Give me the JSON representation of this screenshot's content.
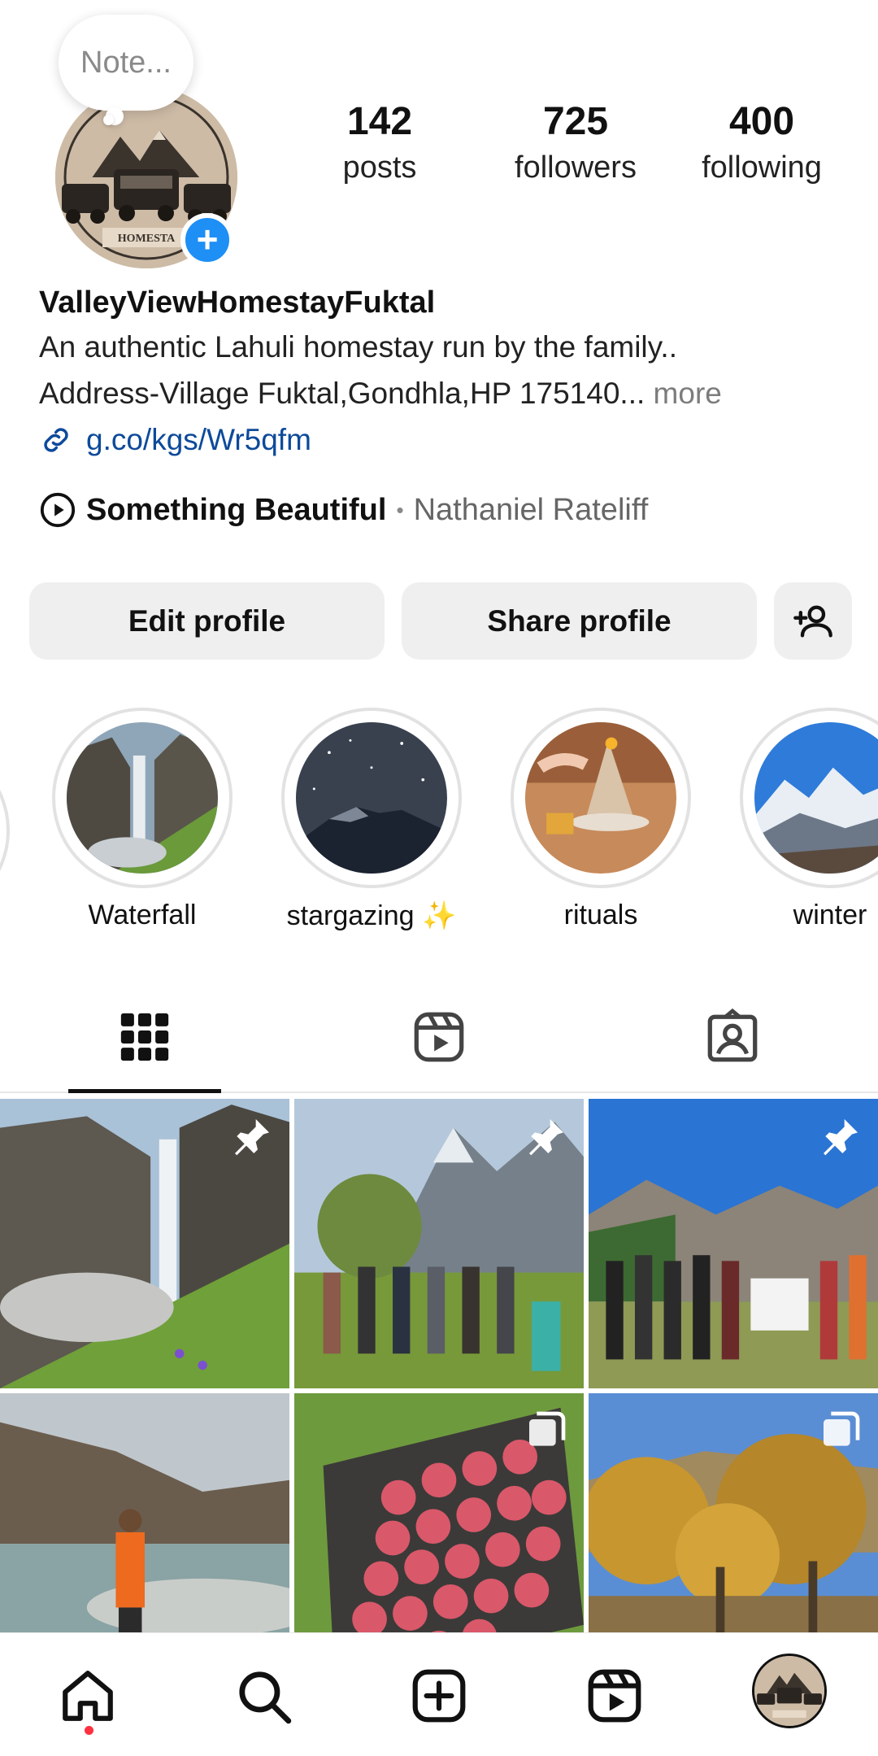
{
  "profile": {
    "note_placeholder": "Note...",
    "avatar_text": "HOMESTA",
    "stats": {
      "posts": {
        "count": "142",
        "label": "posts"
      },
      "followers": {
        "count": "725",
        "label": "followers"
      },
      "following": {
        "count": "400",
        "label": "following"
      }
    },
    "username": "ValleyViewHomestayFuktal",
    "bio_line1": "An authentic Lahuli homestay run by the family..",
    "bio_line2": "Address-Village Fuktal,Gondhla,HP 175140...",
    "bio_more": "more",
    "link": "g.co/kgs/Wr5qfm",
    "music": {
      "song": "Something Beautiful",
      "separator": "•",
      "artist": "Nathaniel Rateliff"
    }
  },
  "actions": {
    "edit_label": "Edit profile",
    "share_label": "Share profile"
  },
  "highlights": [
    {
      "label": "Waterfall"
    },
    {
      "label": "stargazing ✨"
    },
    {
      "label": "rituals"
    },
    {
      "label": "winter"
    }
  ],
  "tabs": {
    "active": "grid",
    "items": [
      "grid-icon",
      "reels-icon",
      "tagged-icon"
    ]
  },
  "colors": {
    "accent_blue": "#1e8ff5",
    "link_blue": "#0d4a9a",
    "notification_red": "#ff3040",
    "button_gray": "#efefef"
  },
  "bottom_nav": {
    "items": [
      "home-icon",
      "search-icon",
      "create-icon",
      "reels-icon",
      "profile-avatar"
    ]
  }
}
